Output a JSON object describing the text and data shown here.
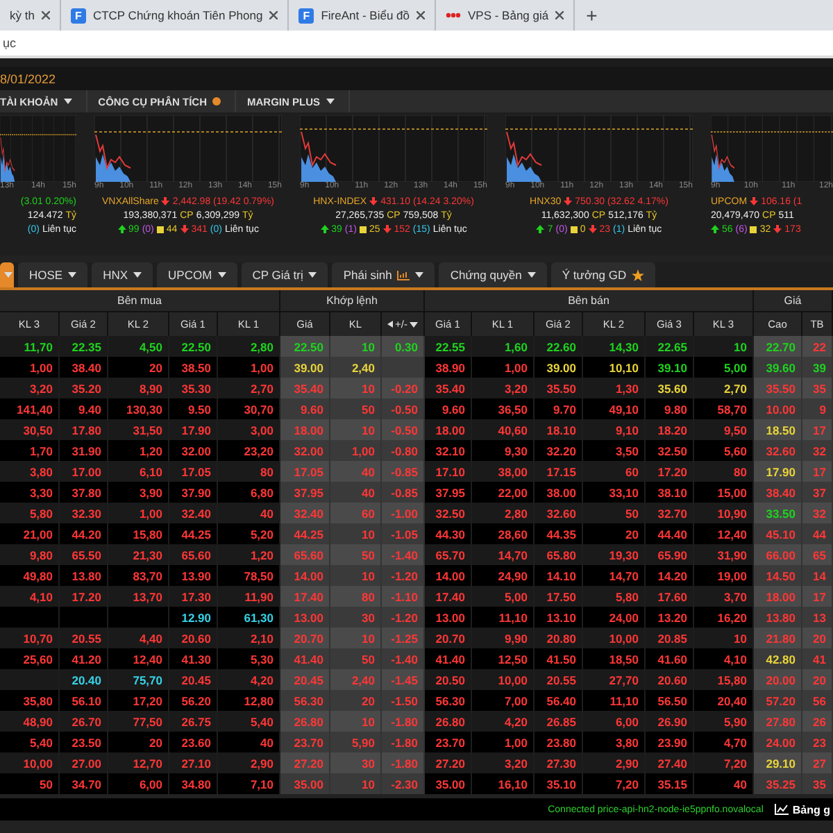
{
  "browser": {
    "tabs": [
      {
        "title": "kỳ th"
      },
      {
        "title": "CTCP Chứng khoán Tiên Phong",
        "favicon": {
          "kind": "letter",
          "letter": "F"
        }
      },
      {
        "title": "FireAnt - Biểu đồ",
        "favicon": {
          "kind": "letter",
          "letter": "F"
        }
      },
      {
        "title": "VPS - Bảng giá",
        "favicon": {
          "kind": "mark"
        }
      }
    ],
    "new_tab": "+",
    "address": "ục"
  },
  "date": "8/01/2022",
  "menu": [
    {
      "label": "TÀI KHOẢN",
      "kind": "caret"
    },
    {
      "label": "CÔNG CỤ PHÂN TÍCH",
      "kind": "dot"
    },
    {
      "label": "MARGIN PLUS",
      "kind": "caret"
    }
  ],
  "indices": [
    {
      "kind": "up",
      "change": "(3.01 0.20%)",
      "value": "124.472",
      "unit": "Tỷ",
      "floor": "(0)",
      "session": "Liên tục",
      "ticks": [
        "13h",
        "14h",
        "15h"
      ]
    },
    {
      "name": "VNXAllShare",
      "kind": "down",
      "change": "2,442.98 (19.42 0.79%)",
      "volume": "193,380,371",
      "cp": "CP",
      "value": "6,309,299",
      "unit": "Tỷ",
      "advances": "99",
      "ceiling": "(0)",
      "unchanged": "44",
      "declines": "341",
      "floor": "(0)",
      "session": "Liên tục",
      "ticks": [
        "9h",
        "10h",
        "11h",
        "12h",
        "13h",
        "14h",
        "15h"
      ]
    },
    {
      "name": "HNX-INDEX",
      "kind": "down",
      "change": "431.10 (14.24 3.20%)",
      "volume": "27,265,735",
      "cp": "CP",
      "value": "759,508",
      "unit": "Tỷ",
      "advances": "39",
      "ceiling": "(1)",
      "unchanged": "25",
      "declines": "152",
      "floor": "(15)",
      "session": "Liên tục",
      "ticks": [
        "9h",
        "10h",
        "11h",
        "12h",
        "13h",
        "14h",
        "15h"
      ]
    },
    {
      "name": "HNX30",
      "kind": "down",
      "change": "750.30 (32.62 4.17%)",
      "volume": "11,632,300",
      "cp": "CP",
      "value": "512,176",
      "unit": "Tỷ",
      "advances": "7",
      "ceiling": "(0)",
      "unchanged": "0",
      "declines": "23",
      "floor": "(1)",
      "session": "Liên tục",
      "ticks": [
        "9h",
        "10h",
        "11h",
        "12h",
        "13h",
        "14h",
        "15h"
      ]
    },
    {
      "name": "UPCOM",
      "kind": "down",
      "change": "106.16 (1",
      "volume": "20,479,470",
      "cp": "CP",
      "value": "511",
      "advances": "56",
      "ceiling": "(6)",
      "unchanged": "32",
      "declines": "173",
      "ticks": [
        "9h",
        "10h",
        "11h",
        "12h"
      ]
    }
  ],
  "filters": [
    {
      "selected": true,
      "kind": "dropdown"
    },
    {
      "label": "HOSE",
      "selected": false,
      "kind": "dropdown"
    },
    {
      "label": "HNX",
      "selected": false,
      "kind": "dropdown"
    },
    {
      "label": "UPCOM",
      "selected": false,
      "kind": "dropdown"
    },
    {
      "label": "CP Giá trị",
      "selected": false,
      "kind": "dropdown"
    },
    {
      "label": "Phái sinh",
      "selected": false,
      "kind": "chart"
    },
    {
      "label": "Chứng quyền",
      "selected": false,
      "kind": "dropdown"
    },
    {
      "label": "Ý tưởng GD",
      "selected": false,
      "kind": "starred"
    }
  ],
  "table": {
    "groups": [
      "Bên mua",
      "Khớp lệnh",
      "Bên bán",
      "Giá"
    ],
    "columns": [
      "KL 3",
      "Giá 2",
      "KL 2",
      "Giá 1",
      "KL 1",
      "Giá",
      "KL",
      "+/-",
      "Giá 1",
      "KL 1",
      "Giá 2",
      "KL 2",
      "Giá 3",
      "KL 3",
      "Cao",
      "TB"
    ],
    "rows": [
      {
        "cells": [
          {
            "text": "11,70",
            "kind": "up"
          },
          {
            "text": "22.35",
            "kind": "up"
          },
          {
            "text": "4,50",
            "kind": "up"
          },
          {
            "text": "22.50",
            "kind": "up"
          },
          {
            "text": "2,80",
            "kind": "up"
          },
          {
            "text": "22.50",
            "kind": "up"
          },
          {
            "text": "10",
            "kind": "up"
          },
          {
            "text": "0.30",
            "kind": "up"
          },
          {
            "text": "22.55",
            "kind": "up"
          },
          {
            "text": "1,60",
            "kind": "up"
          },
          {
            "text": "22.60",
            "kind": "up"
          },
          {
            "text": "14,30",
            "kind": "up"
          },
          {
            "text": "22.65",
            "kind": "up"
          },
          {
            "text": "10",
            "kind": "up"
          },
          {
            "text": "22.70",
            "kind": "up"
          },
          {
            "text": "22",
            "kind": "down"
          }
        ]
      },
      {
        "cells": [
          {
            "text": "1,00",
            "kind": "down"
          },
          {
            "text": "38.40",
            "kind": "down"
          },
          {
            "text": "20",
            "kind": "down"
          },
          {
            "text": "38.50",
            "kind": "down"
          },
          {
            "text": "1,00",
            "kind": "down"
          },
          {
            "text": "39.00",
            "kind": "ref"
          },
          {
            "text": "2,40",
            "kind": "ref"
          },
          null,
          {
            "text": "38.90",
            "kind": "down"
          },
          {
            "text": "1,00",
            "kind": "down"
          },
          {
            "text": "39.00",
            "kind": "ref"
          },
          {
            "text": "10,10",
            "kind": "ref"
          },
          {
            "text": "39.10",
            "kind": "up"
          },
          {
            "text": "5,00",
            "kind": "up"
          },
          {
            "text": "39.60",
            "kind": "up"
          },
          {
            "text": "39",
            "kind": "up"
          }
        ]
      },
      {
        "cells": [
          {
            "text": "3,20",
            "kind": "down"
          },
          {
            "text": "35.20",
            "kind": "down"
          },
          {
            "text": "8,90",
            "kind": "down"
          },
          {
            "text": "35.30",
            "kind": "down"
          },
          {
            "text": "2,70",
            "kind": "down"
          },
          {
            "text": "35.40",
            "kind": "down"
          },
          {
            "text": "10",
            "kind": "down"
          },
          {
            "text": "-0.20",
            "kind": "down"
          },
          {
            "text": "35.40",
            "kind": "down"
          },
          {
            "text": "3,20",
            "kind": "down"
          },
          {
            "text": "35.50",
            "kind": "down"
          },
          {
            "text": "1,30",
            "kind": "down"
          },
          {
            "text": "35.60",
            "kind": "ref"
          },
          {
            "text": "2,70",
            "kind": "ref"
          },
          {
            "text": "35.50",
            "kind": "down"
          },
          {
            "text": "35",
            "kind": "down"
          }
        ]
      },
      {
        "cells": [
          {
            "text": "141,40",
            "kind": "down"
          },
          {
            "text": "9.40",
            "kind": "down"
          },
          {
            "text": "130,30",
            "kind": "down"
          },
          {
            "text": "9.50",
            "kind": "down"
          },
          {
            "text": "30,70",
            "kind": "down"
          },
          {
            "text": "9.60",
            "kind": "down"
          },
          {
            "text": "50",
            "kind": "down"
          },
          {
            "text": "-0.50",
            "kind": "down"
          },
          {
            "text": "9.60",
            "kind": "down"
          },
          {
            "text": "36,50",
            "kind": "down"
          },
          {
            "text": "9.70",
            "kind": "down"
          },
          {
            "text": "49,10",
            "kind": "down"
          },
          {
            "text": "9.80",
            "kind": "down"
          },
          {
            "text": "58,70",
            "kind": "down"
          },
          {
            "text": "10.00",
            "kind": "down"
          },
          {
            "text": "9",
            "kind": "down"
          }
        ]
      },
      {
        "cells": [
          {
            "text": "30,50",
            "kind": "down"
          },
          {
            "text": "17.80",
            "kind": "down"
          },
          {
            "text": "31,50",
            "kind": "down"
          },
          {
            "text": "17.90",
            "kind": "down"
          },
          {
            "text": "3,00",
            "kind": "down"
          },
          {
            "text": "18.00",
            "kind": "down"
          },
          {
            "text": "10",
            "kind": "down"
          },
          {
            "text": "-0.50",
            "kind": "down"
          },
          {
            "text": "18.00",
            "kind": "down"
          },
          {
            "text": "40,60",
            "kind": "down"
          },
          {
            "text": "18.10",
            "kind": "down"
          },
          {
            "text": "9,10",
            "kind": "down"
          },
          {
            "text": "18.20",
            "kind": "down"
          },
          {
            "text": "9,50",
            "kind": "down"
          },
          {
            "text": "18.50",
            "kind": "ref"
          },
          {
            "text": "17",
            "kind": "down"
          }
        ]
      },
      {
        "cells": [
          {
            "text": "1,70",
            "kind": "down"
          },
          {
            "text": "31.90",
            "kind": "down"
          },
          {
            "text": "1,20",
            "kind": "down"
          },
          {
            "text": "32.00",
            "kind": "down"
          },
          {
            "text": "23,20",
            "kind": "down"
          },
          {
            "text": "32.00",
            "kind": "down"
          },
          {
            "text": "1,00",
            "kind": "down"
          },
          {
            "text": "-0.80",
            "kind": "down"
          },
          {
            "text": "32.10",
            "kind": "down"
          },
          {
            "text": "9,30",
            "kind": "down"
          },
          {
            "text": "32.20",
            "kind": "down"
          },
          {
            "text": "3,50",
            "kind": "down"
          },
          {
            "text": "32.50",
            "kind": "down"
          },
          {
            "text": "5,60",
            "kind": "down"
          },
          {
            "text": "32.60",
            "kind": "down"
          },
          {
            "text": "32",
            "kind": "down"
          }
        ]
      },
      {
        "cells": [
          {
            "text": "3,80",
            "kind": "down"
          },
          {
            "text": "17.00",
            "kind": "down"
          },
          {
            "text": "6,10",
            "kind": "down"
          },
          {
            "text": "17.05",
            "kind": "down"
          },
          {
            "text": "80",
            "kind": "down"
          },
          {
            "text": "17.05",
            "kind": "down"
          },
          {
            "text": "40",
            "kind": "down"
          },
          {
            "text": "-0.85",
            "kind": "down"
          },
          {
            "text": "17.10",
            "kind": "down"
          },
          {
            "text": "38,00",
            "kind": "down"
          },
          {
            "text": "17.15",
            "kind": "down"
          },
          {
            "text": "60",
            "kind": "down"
          },
          {
            "text": "17.20",
            "kind": "down"
          },
          {
            "text": "80",
            "kind": "down"
          },
          {
            "text": "17.90",
            "kind": "ref"
          },
          {
            "text": "17",
            "kind": "down"
          }
        ]
      },
      {
        "cells": [
          {
            "text": "3,30",
            "kind": "down"
          },
          {
            "text": "37.80",
            "kind": "down"
          },
          {
            "text": "3,90",
            "kind": "down"
          },
          {
            "text": "37.90",
            "kind": "down"
          },
          {
            "text": "6,80",
            "kind": "down"
          },
          {
            "text": "37.95",
            "kind": "down"
          },
          {
            "text": "40",
            "kind": "down"
          },
          {
            "text": "-0.85",
            "kind": "down"
          },
          {
            "text": "37.95",
            "kind": "down"
          },
          {
            "text": "22,00",
            "kind": "down"
          },
          {
            "text": "38.00",
            "kind": "down"
          },
          {
            "text": "33,10",
            "kind": "down"
          },
          {
            "text": "38.10",
            "kind": "down"
          },
          {
            "text": "15,00",
            "kind": "down"
          },
          {
            "text": "38.40",
            "kind": "down"
          },
          {
            "text": "37",
            "kind": "down"
          }
        ]
      },
      {
        "cells": [
          {
            "text": "5,80",
            "kind": "down"
          },
          {
            "text": "32.30",
            "kind": "down"
          },
          {
            "text": "1,00",
            "kind": "down"
          },
          {
            "text": "32.40",
            "kind": "down"
          },
          {
            "text": "40",
            "kind": "down"
          },
          {
            "text": "32.40",
            "kind": "down"
          },
          {
            "text": "60",
            "kind": "down"
          },
          {
            "text": "-1.00",
            "kind": "down"
          },
          {
            "text": "32.50",
            "kind": "down"
          },
          {
            "text": "2,80",
            "kind": "down"
          },
          {
            "text": "32.60",
            "kind": "down"
          },
          {
            "text": "50",
            "kind": "down"
          },
          {
            "text": "32.70",
            "kind": "down"
          },
          {
            "text": "10,90",
            "kind": "down"
          },
          {
            "text": "33.50",
            "kind": "up"
          },
          {
            "text": "32",
            "kind": "down"
          }
        ]
      },
      {
        "cells": [
          {
            "text": "21,00",
            "kind": "down"
          },
          {
            "text": "44.20",
            "kind": "down"
          },
          {
            "text": "15,80",
            "kind": "down"
          },
          {
            "text": "44.25",
            "kind": "down"
          },
          {
            "text": "5,20",
            "kind": "down"
          },
          {
            "text": "44.25",
            "kind": "down"
          },
          {
            "text": "10",
            "kind": "down"
          },
          {
            "text": "-1.05",
            "kind": "down"
          },
          {
            "text": "44.30",
            "kind": "down"
          },
          {
            "text": "28,60",
            "kind": "down"
          },
          {
            "text": "44.35",
            "kind": "down"
          },
          {
            "text": "20",
            "kind": "down"
          },
          {
            "text": "44.40",
            "kind": "down"
          },
          {
            "text": "12,40",
            "kind": "down"
          },
          {
            "text": "45.10",
            "kind": "down"
          },
          {
            "text": "44",
            "kind": "down"
          }
        ]
      },
      {
        "cells": [
          {
            "text": "9,80",
            "kind": "down"
          },
          {
            "text": "65.50",
            "kind": "down"
          },
          {
            "text": "21,30",
            "kind": "down"
          },
          {
            "text": "65.60",
            "kind": "down"
          },
          {
            "text": "1,20",
            "kind": "down"
          },
          {
            "text": "65.60",
            "kind": "down"
          },
          {
            "text": "50",
            "kind": "down"
          },
          {
            "text": "-1.40",
            "kind": "down"
          },
          {
            "text": "65.70",
            "kind": "down"
          },
          {
            "text": "14,70",
            "kind": "down"
          },
          {
            "text": "65.80",
            "kind": "down"
          },
          {
            "text": "19,30",
            "kind": "down"
          },
          {
            "text": "65.90",
            "kind": "down"
          },
          {
            "text": "31,90",
            "kind": "down"
          },
          {
            "text": "66.00",
            "kind": "down"
          },
          {
            "text": "65",
            "kind": "down"
          }
        ]
      },
      {
        "cells": [
          {
            "text": "49,80",
            "kind": "down"
          },
          {
            "text": "13.80",
            "kind": "down"
          },
          {
            "text": "83,70",
            "kind": "down"
          },
          {
            "text": "13.90",
            "kind": "down"
          },
          {
            "text": "78,50",
            "kind": "down"
          },
          {
            "text": "14.00",
            "kind": "down"
          },
          {
            "text": "10",
            "kind": "down"
          },
          {
            "text": "-1.20",
            "kind": "down"
          },
          {
            "text": "14.00",
            "kind": "down"
          },
          {
            "text": "24,90",
            "kind": "down"
          },
          {
            "text": "14.10",
            "kind": "down"
          },
          {
            "text": "14,70",
            "kind": "down"
          },
          {
            "text": "14.20",
            "kind": "down"
          },
          {
            "text": "19,00",
            "kind": "down"
          },
          {
            "text": "14.50",
            "kind": "down"
          },
          {
            "text": "14",
            "kind": "down"
          }
        ]
      },
      {
        "cells": [
          {
            "text": "4,10",
            "kind": "down"
          },
          {
            "text": "17.20",
            "kind": "down"
          },
          {
            "text": "13,70",
            "kind": "down"
          },
          {
            "text": "17.30",
            "kind": "down"
          },
          {
            "text": "11,90",
            "kind": "down"
          },
          {
            "text": "17.40",
            "kind": "down"
          },
          {
            "text": "80",
            "kind": "down"
          },
          {
            "text": "-1.10",
            "kind": "down"
          },
          {
            "text": "17.40",
            "kind": "down"
          },
          {
            "text": "5,00",
            "kind": "down"
          },
          {
            "text": "17.50",
            "kind": "down"
          },
          {
            "text": "5,80",
            "kind": "down"
          },
          {
            "text": "17.60",
            "kind": "down"
          },
          {
            "text": "3,70",
            "kind": "down"
          },
          {
            "text": "18.00",
            "kind": "down"
          },
          {
            "text": "17",
            "kind": "down"
          }
        ]
      },
      {
        "cells": [
          null,
          null,
          null,
          {
            "text": "12.90",
            "kind": "ceil"
          },
          {
            "text": "61,30",
            "kind": "ceil"
          },
          {
            "text": "13.00",
            "kind": "down"
          },
          {
            "text": "30",
            "kind": "down"
          },
          {
            "text": "-1.20",
            "kind": "down"
          },
          {
            "text": "13.00",
            "kind": "down"
          },
          {
            "text": "11,10",
            "kind": "down"
          },
          {
            "text": "13.10",
            "kind": "down"
          },
          {
            "text": "24,00",
            "kind": "down"
          },
          {
            "text": "13.20",
            "kind": "down"
          },
          {
            "text": "16,20",
            "kind": "down"
          },
          {
            "text": "13.80",
            "kind": "down"
          },
          {
            "text": "13",
            "kind": "down"
          }
        ]
      },
      {
        "cells": [
          {
            "text": "10,70",
            "kind": "down"
          },
          {
            "text": "20.55",
            "kind": "down"
          },
          {
            "text": "4,40",
            "kind": "down"
          },
          {
            "text": "20.60",
            "kind": "down"
          },
          {
            "text": "2,10",
            "kind": "down"
          },
          {
            "text": "20.70",
            "kind": "down"
          },
          {
            "text": "10",
            "kind": "down"
          },
          {
            "text": "-1.25",
            "kind": "down"
          },
          {
            "text": "20.70",
            "kind": "down"
          },
          {
            "text": "9,90",
            "kind": "down"
          },
          {
            "text": "20.80",
            "kind": "down"
          },
          {
            "text": "10,00",
            "kind": "down"
          },
          {
            "text": "20.85",
            "kind": "down"
          },
          {
            "text": "10",
            "kind": "down"
          },
          {
            "text": "21.80",
            "kind": "down"
          },
          {
            "text": "20",
            "kind": "down"
          }
        ]
      },
      {
        "cells": [
          {
            "text": "25,60",
            "kind": "down"
          },
          {
            "text": "41.20",
            "kind": "down"
          },
          {
            "text": "12,40",
            "kind": "down"
          },
          {
            "text": "41.30",
            "kind": "down"
          },
          {
            "text": "5,30",
            "kind": "down"
          },
          {
            "text": "41.40",
            "kind": "down"
          },
          {
            "text": "50",
            "kind": "down"
          },
          {
            "text": "-1.40",
            "kind": "down"
          },
          {
            "text": "41.40",
            "kind": "down"
          },
          {
            "text": "12,50",
            "kind": "down"
          },
          {
            "text": "41.50",
            "kind": "down"
          },
          {
            "text": "18,50",
            "kind": "down"
          },
          {
            "text": "41.60",
            "kind": "down"
          },
          {
            "text": "4,10",
            "kind": "down"
          },
          {
            "text": "42.80",
            "kind": "ref"
          },
          {
            "text": "41",
            "kind": "down"
          }
        ]
      },
      {
        "cells": [
          null,
          {
            "text": "20.40",
            "kind": "ceil"
          },
          {
            "text": "75,70",
            "kind": "ceil"
          },
          {
            "text": "20.45",
            "kind": "down"
          },
          {
            "text": "4,20",
            "kind": "down"
          },
          {
            "text": "20.45",
            "kind": "down"
          },
          {
            "text": "2,40",
            "kind": "down"
          },
          {
            "text": "-1.45",
            "kind": "down"
          },
          {
            "text": "20.50",
            "kind": "down"
          },
          {
            "text": "10,00",
            "kind": "down"
          },
          {
            "text": "20.55",
            "kind": "down"
          },
          {
            "text": "27,70",
            "kind": "down"
          },
          {
            "text": "20.60",
            "kind": "down"
          },
          {
            "text": "15,80",
            "kind": "down"
          },
          {
            "text": "20.00",
            "kind": "down"
          },
          {
            "text": "20",
            "kind": "down"
          }
        ]
      },
      {
        "cells": [
          {
            "text": "35,80",
            "kind": "down"
          },
          {
            "text": "56.10",
            "kind": "down"
          },
          {
            "text": "17,20",
            "kind": "down"
          },
          {
            "text": "56.20",
            "kind": "down"
          },
          {
            "text": "12,80",
            "kind": "down"
          },
          {
            "text": "56.30",
            "kind": "down"
          },
          {
            "text": "20",
            "kind": "down"
          },
          {
            "text": "-1.50",
            "kind": "down"
          },
          {
            "text": "56.30",
            "kind": "down"
          },
          {
            "text": "7,00",
            "kind": "down"
          },
          {
            "text": "56.40",
            "kind": "down"
          },
          {
            "text": "11,10",
            "kind": "down"
          },
          {
            "text": "56.50",
            "kind": "down"
          },
          {
            "text": "20,40",
            "kind": "down"
          },
          {
            "text": "57.20",
            "kind": "down"
          },
          {
            "text": "56",
            "kind": "down"
          }
        ]
      },
      {
        "cells": [
          {
            "text": "48,90",
            "kind": "down"
          },
          {
            "text": "26.70",
            "kind": "down"
          },
          {
            "text": "77,50",
            "kind": "down"
          },
          {
            "text": "26.75",
            "kind": "down"
          },
          {
            "text": "5,40",
            "kind": "down"
          },
          {
            "text": "26.80",
            "kind": "down"
          },
          {
            "text": "10",
            "kind": "down"
          },
          {
            "text": "-1.80",
            "kind": "down"
          },
          {
            "text": "26.80",
            "kind": "down"
          },
          {
            "text": "4,20",
            "kind": "down"
          },
          {
            "text": "26.85",
            "kind": "down"
          },
          {
            "text": "6,00",
            "kind": "down"
          },
          {
            "text": "26.90",
            "kind": "down"
          },
          {
            "text": "5,90",
            "kind": "down"
          },
          {
            "text": "27.80",
            "kind": "down"
          },
          {
            "text": "26",
            "kind": "down"
          }
        ]
      },
      {
        "cells": [
          {
            "text": "5,40",
            "kind": "down"
          },
          {
            "text": "23.50",
            "kind": "down"
          },
          {
            "text": "20",
            "kind": "down"
          },
          {
            "text": "23.60",
            "kind": "down"
          },
          {
            "text": "40",
            "kind": "down"
          },
          {
            "text": "23.70",
            "kind": "down"
          },
          {
            "text": "5,90",
            "kind": "down"
          },
          {
            "text": "-1.80",
            "kind": "down"
          },
          {
            "text": "23.70",
            "kind": "down"
          },
          {
            "text": "1,00",
            "kind": "down"
          },
          {
            "text": "23.80",
            "kind": "down"
          },
          {
            "text": "3,80",
            "kind": "down"
          },
          {
            "text": "23.90",
            "kind": "down"
          },
          {
            "text": "4,70",
            "kind": "down"
          },
          {
            "text": "24.00",
            "kind": "down"
          },
          {
            "text": "23",
            "kind": "down"
          }
        ]
      },
      {
        "cells": [
          {
            "text": "10,00",
            "kind": "down"
          },
          {
            "text": "27.00",
            "kind": "down"
          },
          {
            "text": "12,70",
            "kind": "down"
          },
          {
            "text": "27.10",
            "kind": "down"
          },
          {
            "text": "2,90",
            "kind": "down"
          },
          {
            "text": "27.20",
            "kind": "down"
          },
          {
            "text": "30",
            "kind": "down"
          },
          {
            "text": "-1.80",
            "kind": "down"
          },
          {
            "text": "27.20",
            "kind": "down"
          },
          {
            "text": "3,20",
            "kind": "down"
          },
          {
            "text": "27.30",
            "kind": "down"
          },
          {
            "text": "2,90",
            "kind": "down"
          },
          {
            "text": "27.40",
            "kind": "down"
          },
          {
            "text": "7,20",
            "kind": "down"
          },
          {
            "text": "29.10",
            "kind": "ref"
          },
          {
            "text": "27",
            "kind": "down"
          }
        ]
      },
      {
        "cells": [
          {
            "text": "50",
            "kind": "down"
          },
          {
            "text": "34.70",
            "kind": "down"
          },
          {
            "text": "6,00",
            "kind": "down"
          },
          {
            "text": "34.80",
            "kind": "down"
          },
          {
            "text": "7,10",
            "kind": "down"
          },
          {
            "text": "35.00",
            "kind": "down"
          },
          {
            "text": "10",
            "kind": "down"
          },
          {
            "text": "-2.30",
            "kind": "down"
          },
          {
            "text": "35.00",
            "kind": "down"
          },
          {
            "text": "16,10",
            "kind": "down"
          },
          {
            "text": "35.10",
            "kind": "down"
          },
          {
            "text": "7,20",
            "kind": "down"
          },
          {
            "text": "35.15",
            "kind": "down"
          },
          {
            "text": "40",
            "kind": "down"
          },
          {
            "text": "35.25",
            "kind": "down"
          },
          {
            "text": "35",
            "kind": "down"
          }
        ]
      }
    ]
  },
  "status_bar": {
    "connection": "Connected price-api-hn2-node-ie5ppnfo.novalocal",
    "link": "Bảng g"
  }
}
